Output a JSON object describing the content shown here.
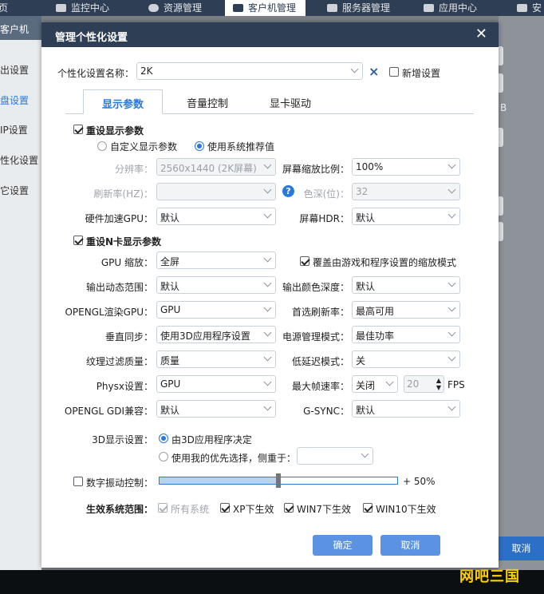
{
  "topbar": {
    "items": [
      {
        "label": "首页",
        "icon": "home-icon"
      },
      {
        "label": "监控中心",
        "icon": "monitor-icon"
      },
      {
        "label": "资源管理",
        "icon": "gamepad-icon"
      },
      {
        "label": "客户机管理",
        "icon": "client-icon"
      },
      {
        "label": "服务器管理",
        "icon": "server-icon"
      },
      {
        "label": "应用中心",
        "icon": "app-icon"
      },
      {
        "label": "安",
        "icon": "shield-icon"
      }
    ]
  },
  "sidebar": {
    "header": "客户机",
    "items": [
      "出设置",
      "盘设置",
      "IP设置",
      "性化设置",
      "它设置"
    ]
  },
  "background": {
    "cancel_label": "取消",
    "side_text": "B"
  },
  "watermark": "网吧三国",
  "dialog": {
    "title": "管理个性化设置",
    "name_label": "个性化设置名称：",
    "name_value": "2K",
    "clear_symbol": "×",
    "new_setting_label": "新增设置",
    "tabs": [
      "显示参数",
      "音量控制",
      "显卡驱动"
    ],
    "reset_display_label": "重设显示参数",
    "radio_custom": "自定义显示参数",
    "radio_recommended": "使用系统推荐值",
    "resolution_label": "分辨率：",
    "resolution_value": "2560x1440 (2K屏幕)",
    "scaling_label": "屏幕缩放比例：",
    "scaling_value": "100%",
    "refresh_label": "刷新率(HZ)：",
    "refresh_value": "",
    "help_symbol": "?",
    "color_depth_label": "色深(位)：",
    "color_depth_value": "32",
    "hw_gpu_label": "硬件加速GPU：",
    "hw_gpu_value": "默认",
    "hdr_label": "屏幕HDR：",
    "hdr_value": "默认",
    "reset_nvidia_label": "重设N卡显示参数",
    "gpu_scaling_label": "GPU 缩放：",
    "gpu_scaling_value": "全屏",
    "override_label": "覆盖由游戏和程序设置的缩放模式",
    "dyn_range_label": "输出动态范围：",
    "dyn_range_value": "默认",
    "color_format_label": "输出颜色深度：",
    "color_format_value": "默认",
    "opengl_gpu_label": "OPENGL渲染GPU：",
    "opengl_gpu_value": "GPU",
    "pref_refresh_label": "首选刷新率：",
    "pref_refresh_value": "最高可用",
    "vsync_label": "垂直同步：",
    "vsync_value": "使用3D应用程序设置",
    "power_label": "电源管理模式：",
    "power_value": "最佳功率",
    "texture_label": "纹理过滤质量：",
    "texture_value": "质量",
    "low_latency_label": "低延迟模式：",
    "low_latency_value": "关",
    "physx_label": "Physx设置：",
    "physx_value": "GPU",
    "max_fps_label": "最大帧速率：",
    "max_fps_value": "关闭",
    "fps_number": "20",
    "fps_unit": "FPS",
    "gdi_label": "OPENGL GDI兼容：",
    "gdi_value": "默认",
    "gsync_label": "G-SYNC：",
    "gsync_value": "默认",
    "display3d_label": "3D显示设置：",
    "display3d_opt1": "由3D应用程序决定",
    "display3d_opt2": "使用我的优先选择，侧重于：",
    "display3d_pref_value": "",
    "vibrance_label": "数字振动控制：",
    "vibrance_value_text": "+ 50%",
    "vibrance_level": 0.5,
    "effective_label": "生效系统范围：",
    "sys_all": "所有系统",
    "sys_xp": "XP下生效",
    "sys_win7": "WIN7下生效",
    "sys_win10": "WIN10下生效",
    "ok_label": "确定",
    "cancel_label": "取消",
    "colors": {
      "header": "#2d3e55",
      "accent": "#2a79d6",
      "button": "#5b93e2"
    }
  }
}
